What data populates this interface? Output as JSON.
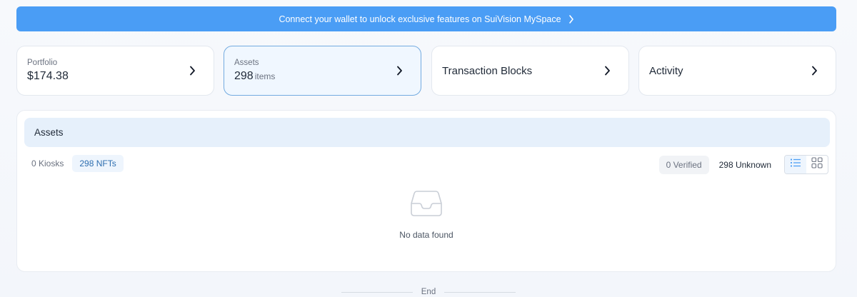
{
  "banner": {
    "text": "Connect your wallet to unlock exclusive features on SuiVision MySpace",
    "icon": "chevron-right-icon"
  },
  "cards": {
    "portfolio": {
      "label": "Portfolio",
      "value": "$174.38"
    },
    "assets": {
      "label": "Assets",
      "value": "298",
      "unit": "items"
    },
    "transaction_blocks": {
      "title": "Transaction Blocks"
    },
    "activity": {
      "title": "Activity"
    }
  },
  "panel": {
    "header": "Assets",
    "tabs": [
      {
        "label": "0 Kiosks",
        "active": false
      },
      {
        "label": "298 NFTs",
        "active": true
      }
    ],
    "filters": {
      "verified": "0 Verified",
      "unknown": "298 Unknown"
    },
    "view_modes": [
      "list-view-icon",
      "grid-view-icon"
    ],
    "empty_message": "No data found"
  },
  "footer": {
    "end_label": "End"
  },
  "colors": {
    "accent": "#4a9df5",
    "active_tab_text": "#2f6fb0",
    "header_bg": "#e6f0fb"
  }
}
